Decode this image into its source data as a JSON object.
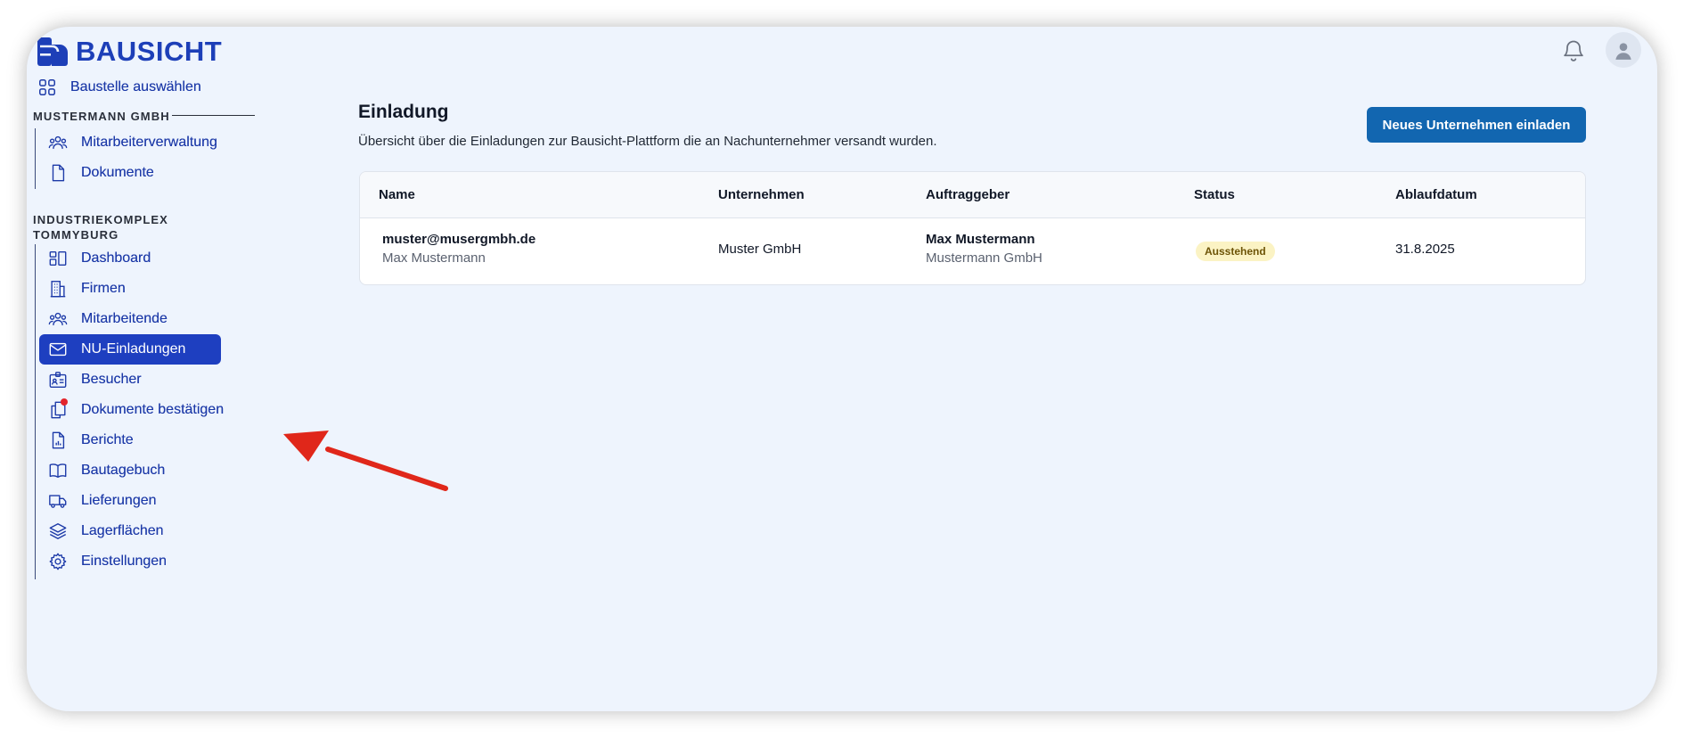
{
  "app": {
    "name": "BAUSICHT"
  },
  "sidebar": {
    "select_site": "Baustelle auswählen",
    "company_section": "MUSTERMANN GMBH",
    "company_items": [
      {
        "label": "Mitarbeiterverwaltung",
        "icon": "users-icon"
      },
      {
        "label": "Dokumente",
        "icon": "document-icon"
      }
    ],
    "site_section_line1": "INDUSTRIEKOMPLEX",
    "site_section_line2": "TOMMYBURG",
    "site_items": [
      {
        "label": "Dashboard",
        "icon": "dashboard-icon"
      },
      {
        "label": "Firmen",
        "icon": "building-icon"
      },
      {
        "label": "Mitarbeitende",
        "icon": "users-icon"
      },
      {
        "label": "NU-Einladungen",
        "icon": "envelope-icon",
        "active": true
      },
      {
        "label": "Besucher",
        "icon": "id-card-icon"
      },
      {
        "label": "Dokumente bestätigen",
        "icon": "documents-icon",
        "badge": true
      },
      {
        "label": "Berichte",
        "icon": "report-icon"
      },
      {
        "label": "Bautagebuch",
        "icon": "book-icon"
      },
      {
        "label": "Lieferungen",
        "icon": "truck-icon"
      },
      {
        "label": "Lagerflächen",
        "icon": "layers-icon"
      },
      {
        "label": "Einstellungen",
        "icon": "gear-icon"
      }
    ]
  },
  "main": {
    "title": "Einladung",
    "subtitle": "Übersicht über die Einladungen zur Bausicht-Plattform die an Nachunternehmer versandt wurden.",
    "invite_button": "Neues Unternehmen einladen",
    "table": {
      "headers": [
        "Name",
        "Unternehmen",
        "Auftraggeber",
        "Status",
        "Ablaufdatum"
      ],
      "rows": [
        {
          "email": "muster@musergmbh.de",
          "name": "Max Mustermann",
          "company": "Muster GmbH",
          "client_name": "Max Mustermann",
          "client_company": "Mustermann GmbH",
          "status": "Ausstehend",
          "expiry": "31.8.2025"
        }
      ]
    }
  },
  "colors": {
    "brand": "#1d3fb8",
    "active_nav": "#1e3fc0",
    "primary_button": "#1266b0",
    "status_pending_bg": "#fbf3c4",
    "annotation_arrow": "#e0271a",
    "notification_dot": "#e3242b"
  }
}
